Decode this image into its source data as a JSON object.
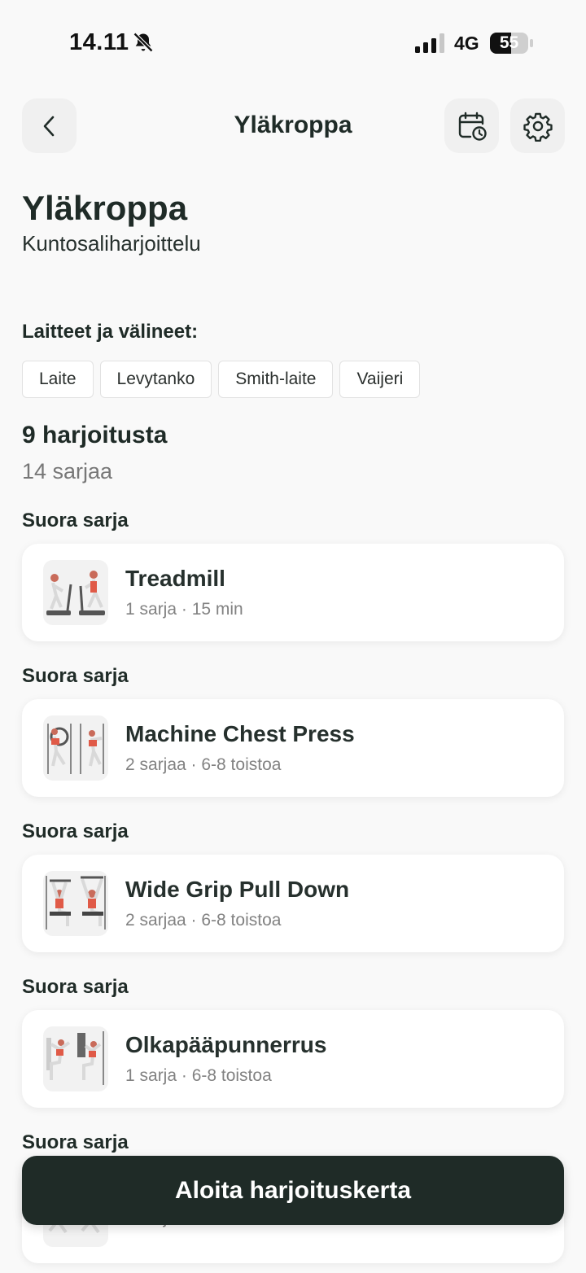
{
  "status": {
    "time": "14.11",
    "network": "4G",
    "battery": "55",
    "battery_level": 0.55
  },
  "header": {
    "title": "Yläkroppa"
  },
  "page": {
    "title": "Yläkroppa",
    "subtitle": "Kuntosaliharjoittelu"
  },
  "equipment": {
    "label": "Laitteet ja välineet:",
    "chips": [
      "Laite",
      "Levytanko",
      "Smith-laite",
      "Vaijeri"
    ]
  },
  "summary": {
    "exercises": "9 harjoitusta",
    "sets": "14 sarjaa"
  },
  "groups": [
    {
      "label": "Suora sarja",
      "exercise": {
        "name": "Treadmill",
        "meta": "1 sarja · 15 min"
      }
    },
    {
      "label": "Suora sarja",
      "exercise": {
        "name": "Machine Chest Press",
        "meta": "2 sarjaa · 6-8 toistoa"
      }
    },
    {
      "label": "Suora sarja",
      "exercise": {
        "name": "Wide Grip Pull Down",
        "meta": "2 sarjaa · 6-8 toistoa"
      }
    },
    {
      "label": "Suora sarja",
      "exercise": {
        "name": "Olkapääpunnerrus",
        "meta": "1 sarja · 6-8 toistoa"
      }
    },
    {
      "label": "Suora sarja",
      "exercise": {
        "name": "",
        "meta": "1 sarja · 6-8 toistoa"
      }
    }
  ],
  "cta": {
    "label": "Aloita harjoituskerta"
  },
  "icons": {
    "back": "chevron-left-icon",
    "calendar": "calendar-clock-icon",
    "settings": "gear-icon",
    "mute": "bell-off-icon",
    "signal": "signal-icon"
  },
  "colors": {
    "primary": "#1f2b27",
    "background": "#f9f9f9",
    "muted": "#828282"
  }
}
